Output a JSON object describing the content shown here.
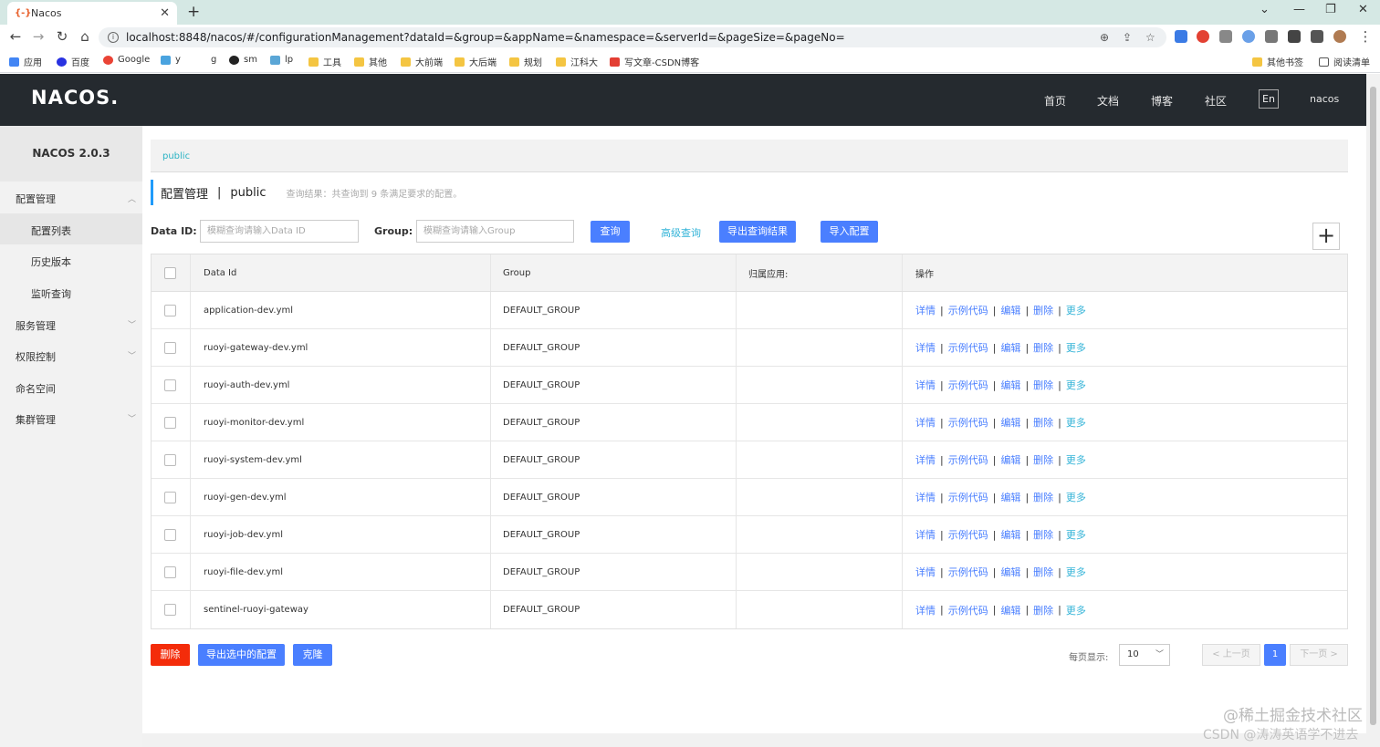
{
  "browser": {
    "tab_title": "Nacos",
    "tab_favicon": "{-}",
    "url": "localhost:8848/nacos/#/configurationManagement?dataId=&group=&appName=&namespace=&serverId=&pageSize=&pageNo=",
    "bookmarks": [
      "应用",
      "百度",
      "Google",
      "y",
      "g",
      "sm",
      "lp",
      "工具",
      "其他",
      "大前端",
      "大后端",
      "规划",
      "江科大",
      "写文章-CSDN博客"
    ],
    "other_bookmarks": "其他书签",
    "reading_list": "阅读清单"
  },
  "header": {
    "logo": "NACOS.",
    "nav": [
      "首页",
      "文档",
      "博客",
      "社区"
    ],
    "lang": "En",
    "user": "nacos"
  },
  "sidebar": {
    "title": "NACOS 2.0.3",
    "config_mgmt": "配置管理",
    "config_list": "配置列表",
    "history": "历史版本",
    "listen_query": "监听查询",
    "service_mgmt": "服务管理",
    "auth_control": "权限控制",
    "namespace": "命名空间",
    "cluster_mgmt": "集群管理"
  },
  "main": {
    "namespace_tab": "public",
    "page_title": "配置管理",
    "title_sep": "|",
    "namespace": "public",
    "query_result": "查询结果：共查询到 9 条满足要求的配置。",
    "dataid_label": "Data ID:",
    "dataid_placeholder": "模糊查询请输入Data ID",
    "group_label": "Group:",
    "group_placeholder": "模糊查询请输入Group",
    "query_btn": "查询",
    "advanced_query": "高级查询",
    "export_query_btn": "导出查询结果",
    "import_btn": "导入配置",
    "plus": "+"
  },
  "table": {
    "columns": [
      "Data Id",
      "Group",
      "归属应用:",
      "操作"
    ],
    "ops": [
      "详情",
      "示例代码",
      "编辑",
      "删除",
      "更多"
    ],
    "sep": "|",
    "rows": [
      {
        "data_id": "application-dev.yml",
        "group": "DEFAULT_GROUP",
        "app": ""
      },
      {
        "data_id": "ruoyi-gateway-dev.yml",
        "group": "DEFAULT_GROUP",
        "app": ""
      },
      {
        "data_id": "ruoyi-auth-dev.yml",
        "group": "DEFAULT_GROUP",
        "app": ""
      },
      {
        "data_id": "ruoyi-monitor-dev.yml",
        "group": "DEFAULT_GROUP",
        "app": ""
      },
      {
        "data_id": "ruoyi-system-dev.yml",
        "group": "DEFAULT_GROUP",
        "app": ""
      },
      {
        "data_id": "ruoyi-gen-dev.yml",
        "group": "DEFAULT_GROUP",
        "app": ""
      },
      {
        "data_id": "ruoyi-job-dev.yml",
        "group": "DEFAULT_GROUP",
        "app": ""
      },
      {
        "data_id": "ruoyi-file-dev.yml",
        "group": "DEFAULT_GROUP",
        "app": ""
      },
      {
        "data_id": "sentinel-ruoyi-gateway",
        "group": "DEFAULT_GROUP",
        "app": ""
      }
    ]
  },
  "footer": {
    "delete_btn": "删除",
    "export_selected_btn": "导出选中的配置",
    "clone_btn": "克隆",
    "page_size_label": "每页显示:",
    "page_size": "10",
    "prev": "< 上一页",
    "current_page": "1",
    "next": "下一页 >"
  },
  "watermark": {
    "line1": "@稀土掘金技术社区",
    "line2": "CSDN @涛涛英语学不进去"
  },
  "colors": {
    "primary": "#4a7fff",
    "link": "#35b4d8",
    "danger": "#f42c0a",
    "header_bg": "#252a2f"
  }
}
